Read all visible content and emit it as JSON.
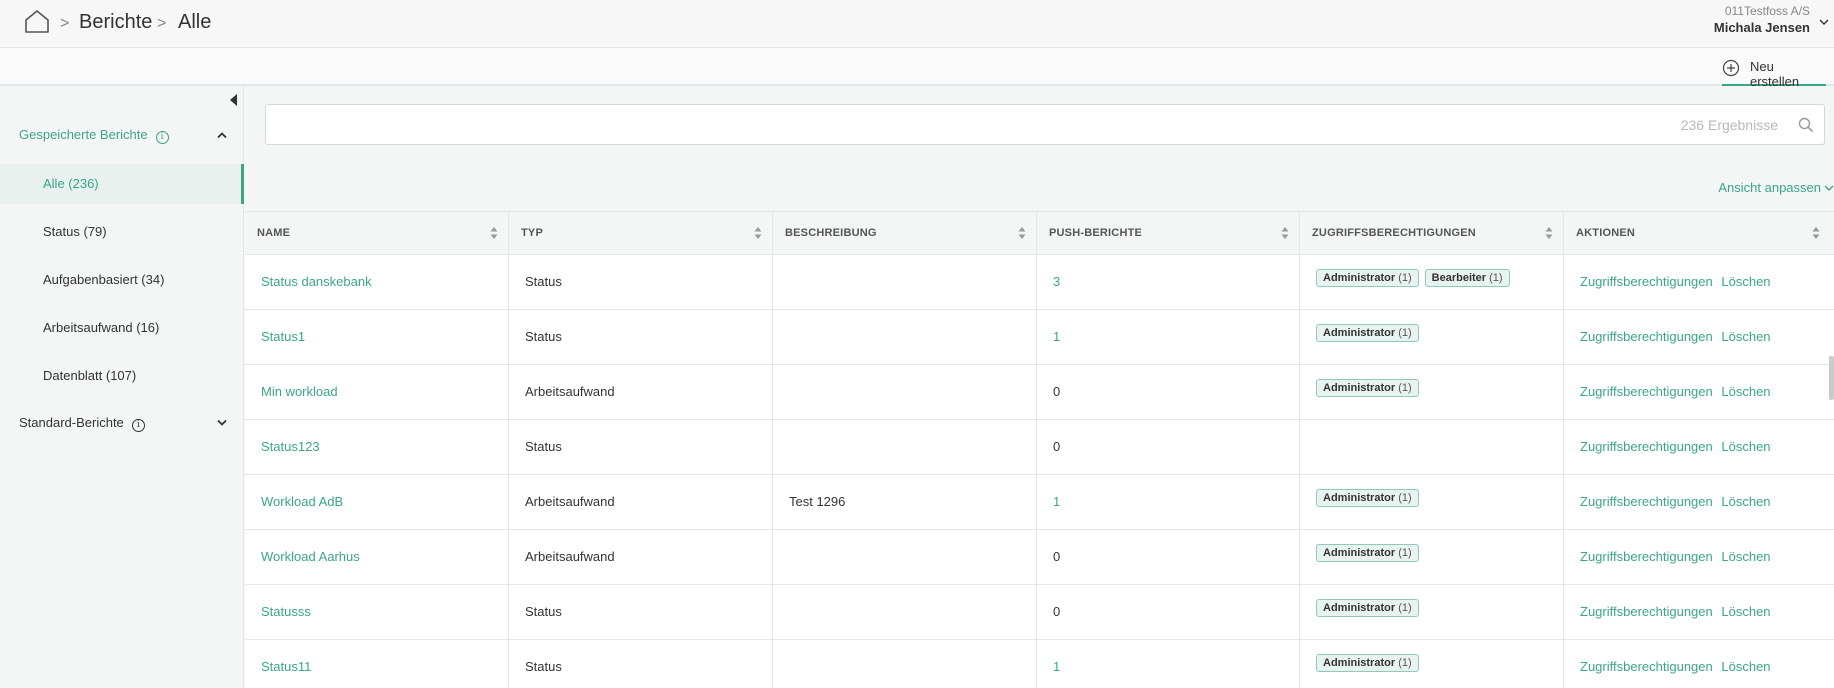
{
  "breadcrumb": {
    "items": [
      "Berichte",
      "Alle"
    ]
  },
  "account": {
    "org": "011Testfoss A/S",
    "user": "Michala Jensen"
  },
  "toolbar": {
    "new_label": "Neu erstellen"
  },
  "sidebar": {
    "saved_section": "Gespeicherte Berichte",
    "items": [
      {
        "label": "Alle (236)"
      },
      {
        "label": "Status (79)"
      },
      {
        "label": "Aufgabenbasiert (34)"
      },
      {
        "label": "Arbeitsaufwand (16)"
      },
      {
        "label": "Datenblatt (107)"
      }
    ],
    "standard_section": "Standard-Berichte"
  },
  "search": {
    "placeholder": "236 Ergebnisse"
  },
  "view_adjust_label": "Ansicht anpassen",
  "table": {
    "headers": [
      "NAME",
      "TYP",
      "BESCHREIBUNG",
      "PUSH-BERICHTE",
      "ZUGRIFFSBERECHTIGUNGEN",
      "AKTIONEN"
    ],
    "action_labels": {
      "access": "Zugriffsberechtigungen",
      "delete": "Löschen"
    },
    "rows": [
      {
        "name": "Status danskebank",
        "type": "Status",
        "description": "",
        "push": "3",
        "badges": [
          {
            "label": "Administrator",
            "count": "(1)"
          },
          {
            "label": "Bearbeiter",
            "count": "(1)"
          }
        ]
      },
      {
        "name": "Status1",
        "type": "Status",
        "description": "",
        "push": "1",
        "badges": [
          {
            "label": "Administrator",
            "count": "(1)"
          }
        ]
      },
      {
        "name": "Min workload",
        "type": "Arbeitsaufwand",
        "description": "",
        "push": "0",
        "badges": [
          {
            "label": "Administrator",
            "count": "(1)"
          }
        ]
      },
      {
        "name": "Status123",
        "type": "Status",
        "description": "",
        "push": "0",
        "badges": []
      },
      {
        "name": "Workload AdB",
        "type": "Arbeitsaufwand",
        "description": "Test 1296",
        "push": "1",
        "badges": [
          {
            "label": "Administrator",
            "count": "(1)"
          }
        ]
      },
      {
        "name": "Workload Aarhus",
        "type": "Arbeitsaufwand",
        "description": "",
        "push": "0",
        "badges": [
          {
            "label": "Administrator",
            "count": "(1)"
          }
        ]
      },
      {
        "name": "Statusss",
        "type": "Status",
        "description": "",
        "push": "0",
        "badges": [
          {
            "label": "Administrator",
            "count": "(1)"
          }
        ]
      },
      {
        "name": "Status11",
        "type": "Status",
        "description": "",
        "push": "1",
        "badges": [
          {
            "label": "Administrator",
            "count": "(1)"
          }
        ]
      }
    ]
  },
  "colors": {
    "accent": "#3ba58a",
    "border": "#e3e6e6"
  }
}
